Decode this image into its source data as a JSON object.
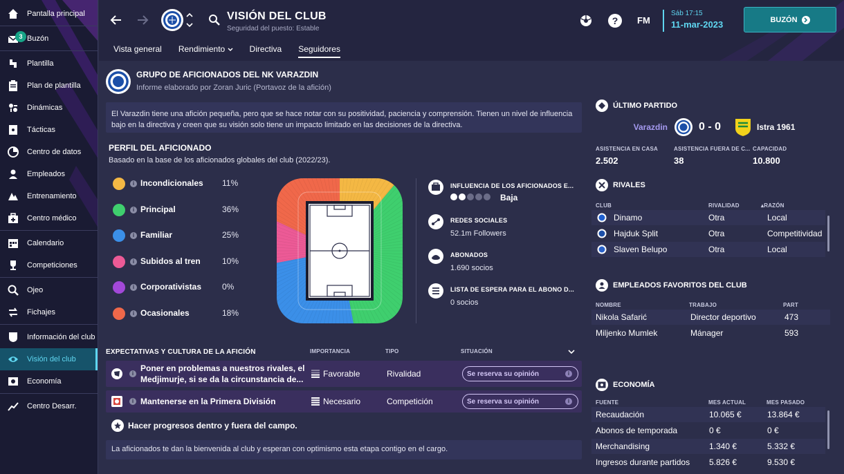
{
  "sidebar": {
    "items": [
      {
        "label": "Pantalla principal",
        "icon": "home-icon"
      },
      {
        "label": "Buzón",
        "icon": "inbox-icon",
        "badge": "3"
      },
      {
        "label": "Plantilla",
        "icon": "squad-icon"
      },
      {
        "label": "Plan de plantilla",
        "icon": "clipboard-icon"
      },
      {
        "label": "Dinámicas",
        "icon": "dynamics-icon"
      },
      {
        "label": "Tácticas",
        "icon": "tactics-icon"
      },
      {
        "label": "Centro de datos",
        "icon": "data-icon"
      },
      {
        "label": "Empleados",
        "icon": "staff-icon"
      },
      {
        "label": "Entrenamiento",
        "icon": "training-icon"
      },
      {
        "label": "Centro médico",
        "icon": "medical-icon"
      },
      {
        "label": "Calendario",
        "icon": "calendar-icon"
      },
      {
        "label": "Competiciones",
        "icon": "trophy-icon"
      },
      {
        "label": "Ojeo",
        "icon": "scouting-icon"
      },
      {
        "label": "Fichajes",
        "icon": "transfers-icon"
      },
      {
        "label": "Información del club",
        "icon": "club-info-icon"
      },
      {
        "label": "Visión del club",
        "icon": "club-vision-icon"
      },
      {
        "label": "Economía",
        "icon": "finances-icon"
      },
      {
        "label": "Centro Desarr.",
        "icon": "development-icon"
      }
    ]
  },
  "header": {
    "title": "VISIÓN DEL CLUB",
    "subtitle": "Seguridad del puesto: Estable",
    "fm_label": "FM",
    "date_time": "Sáb 17:15",
    "date": "11-mar-2023",
    "continue_label": "BUZÓN",
    "tabs": [
      "Vista general",
      "Rendimiento",
      "Directiva",
      "Seguidores"
    ]
  },
  "group": {
    "title": "GRUPO DE AFICIONADOS DEL NK VARAZDIN",
    "subtitle": "Informe elaborado por Zoran Juric (Portavoz de la afición)",
    "description": "El Varazdin tiene una afición pequeña, pero que se hace notar con su positividad, paciencia y comprensión. Tienen un nivel de influencia bajo en la directiva y creen que su visión solo tiene un impacto limitado en las decisiones de la directiva."
  },
  "profile": {
    "title": "PERFIL DEL AFICIONADO",
    "subtitle": "Basado en la base de los aficionados globales del club (2022/23).",
    "segments": [
      {
        "label": "Incondicionales",
        "pct": "11%",
        "value": 11,
        "color": "#f4b844"
      },
      {
        "label": "Principal",
        "pct": "36%",
        "value": 36,
        "color": "#3fcf6e"
      },
      {
        "label": "Familiar",
        "pct": "25%",
        "value": 25,
        "color": "#3b8fe8"
      },
      {
        "label": "Subidos al tren",
        "pct": "10%",
        "value": 10,
        "color": "#ec5a96"
      },
      {
        "label": "Corporativistas",
        "pct": "0%",
        "value": 0,
        "color": "#a248d8"
      },
      {
        "label": "Ocasionales",
        "pct": "18%",
        "value": 18,
        "color": "#f0684a"
      }
    ]
  },
  "stats": {
    "influence_title": "INFLUENCIA DE LOS AFICIONADOS E...",
    "influence_value": "Baja",
    "influence_level": 2,
    "social_title": "REDES SOCIALES",
    "social_value": "52.1m Followers",
    "season_title": "ABONADOS",
    "season_value": "1.690 socios",
    "waiting_title": "LISTA DE ESPERA PARA EL ABONO D...",
    "waiting_value": "0 socios"
  },
  "expectations": {
    "title": "EXPECTATIVAS Y CULTURA DE LA AFICIÓN",
    "col_importance": "IMPORTANCIA",
    "col_type": "TIPO",
    "col_situation": "SITUACIÓN",
    "rows": [
      {
        "line1": "Poner en problemas a nuestros rivales, el",
        "line2": "Medjimurje, si se da la circunstancia de...",
        "importance": "Favorable",
        "type": "Rivalidad",
        "situation": "Se reserva su opinión"
      },
      {
        "line1": "Mantenerse en la Primera División",
        "importance": "Necesario",
        "type": "Competición",
        "situation": "Se reserva su opinión"
      }
    ],
    "culture": "Hacer progresos dentro y fuera del campo.",
    "footer": "La aficionados te dan la bienvenida al club y esperan con optimismo esta etapa contigo en el cargo."
  },
  "last_match": {
    "title": "ÚLTIMO PARTIDO",
    "home": "Varazdin",
    "score": "0 - 0",
    "away": "Istra 1961",
    "home_att_label": "ASISTENCIA EN CASA",
    "home_att": "2.502",
    "away_att_label": "ASISTENCIA FUERA DE C...",
    "away_att": "38",
    "capacity_label": "CAPACIDAD",
    "capacity": "10.800"
  },
  "rivals": {
    "title": "RIVALES",
    "col_club": "CLUB",
    "col_rivalry": "RIVALIDAD",
    "col_reason": "RAZÓN",
    "rows": [
      {
        "club": "Dinamo",
        "rivalry": "Otra",
        "reason": "Local"
      },
      {
        "club": "Hajduk Split",
        "rivalry": "Otra",
        "reason": "Competitividad"
      },
      {
        "club": "Slaven Belupo",
        "rivalry": "Otra",
        "reason": "Local"
      }
    ]
  },
  "favourites": {
    "title": "EMPLEADOS FAVORITOS DEL CLUB",
    "col_name": "NOMBRE",
    "col_job": "TRABAJO",
    "col_part": "PART",
    "rows": [
      {
        "name": "Nikola Safarić",
        "job": "Director deportivo",
        "part": "473"
      },
      {
        "name": "Miljenko Mumlek",
        "job": "Mánager",
        "part": "593"
      }
    ]
  },
  "economy": {
    "title": "ECONOMÍA",
    "col_source": "FUENTE",
    "col_current": "MES ACTUAL",
    "col_last": "MES PASADO",
    "rows": [
      {
        "source": "Recaudación",
        "current": "10.065 €",
        "last": "13.864 €"
      },
      {
        "source": "Abonos de temporada",
        "current": "0 €",
        "last": "0 €"
      },
      {
        "source": "Merchandising",
        "current": "1.340 €",
        "last": "5.332 €"
      },
      {
        "source": "Ingresos durante partidos",
        "current": "5.826 €",
        "last": "9.530 €"
      }
    ]
  }
}
